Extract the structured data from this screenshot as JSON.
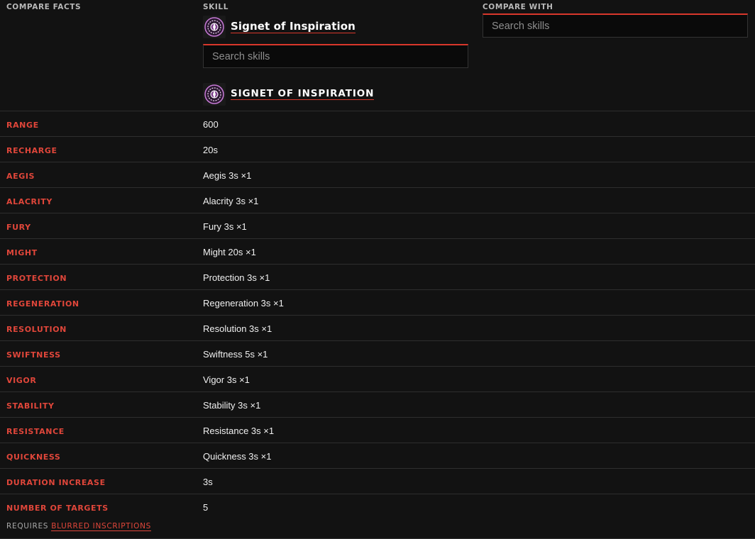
{
  "header": {
    "compare_facts_label": "COMPARE FACTS",
    "skill_label": "SKILL",
    "compare_with_label": "COMPARE WITH"
  },
  "skill": {
    "name": "Signet of Inspiration",
    "heading": "SIGNET OF INSPIRATION",
    "icon": "signet-icon",
    "search_placeholder": "Search skills"
  },
  "compare": {
    "search_placeholder": "Search skills"
  },
  "colors": {
    "accent": "#d8372b",
    "label": "#e0463a",
    "background": "#121212"
  },
  "facts": [
    {
      "label": "RANGE",
      "value": "600"
    },
    {
      "label": "RECHARGE",
      "value": "20s"
    },
    {
      "label": "AEGIS",
      "value": "Aegis 3s ×1"
    },
    {
      "label": "ALACRITY",
      "value": "Alacrity 3s ×1"
    },
    {
      "label": "FURY",
      "value": "Fury 3s ×1"
    },
    {
      "label": "MIGHT",
      "value": "Might 20s ×1"
    },
    {
      "label": "PROTECTION",
      "value": "Protection 3s ×1"
    },
    {
      "label": "REGENERATION",
      "value": "Regeneration 3s ×1"
    },
    {
      "label": "RESOLUTION",
      "value": "Resolution 3s ×1"
    },
    {
      "label": "SWIFTNESS",
      "value": "Swiftness 5s ×1"
    },
    {
      "label": "VIGOR",
      "value": "Vigor 3s ×1"
    },
    {
      "label": "STABILITY",
      "value": "Stability 3s ×1"
    },
    {
      "label": "RESISTANCE",
      "value": "Resistance 3s ×1"
    },
    {
      "label": "QUICKNESS",
      "value": "Quickness 3s ×1"
    },
    {
      "label": "DURATION INCREASE",
      "value": "3s"
    },
    {
      "label": "NUMBER OF TARGETS",
      "value": "5"
    }
  ],
  "requires": {
    "prefix": "REQUIRES",
    "trait": "BLURRED INSCRIPTIONS"
  }
}
